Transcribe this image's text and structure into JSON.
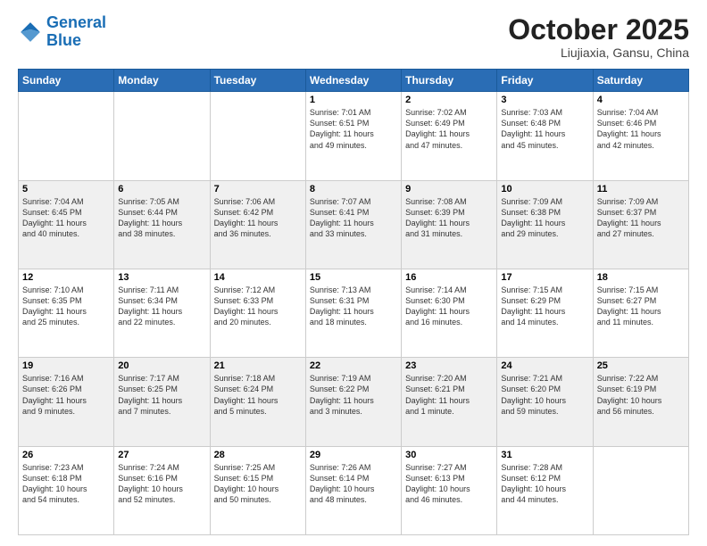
{
  "header": {
    "logo_line1": "General",
    "logo_line2": "Blue",
    "month": "October 2025",
    "location": "Liujiaxia, Gansu, China"
  },
  "days_of_week": [
    "Sunday",
    "Monday",
    "Tuesday",
    "Wednesday",
    "Thursday",
    "Friday",
    "Saturday"
  ],
  "weeks": [
    [
      {
        "day": "",
        "info": ""
      },
      {
        "day": "",
        "info": ""
      },
      {
        "day": "",
        "info": ""
      },
      {
        "day": "1",
        "info": "Sunrise: 7:01 AM\nSunset: 6:51 PM\nDaylight: 11 hours\nand 49 minutes."
      },
      {
        "day": "2",
        "info": "Sunrise: 7:02 AM\nSunset: 6:49 PM\nDaylight: 11 hours\nand 47 minutes."
      },
      {
        "day": "3",
        "info": "Sunrise: 7:03 AM\nSunset: 6:48 PM\nDaylight: 11 hours\nand 45 minutes."
      },
      {
        "day": "4",
        "info": "Sunrise: 7:04 AM\nSunset: 6:46 PM\nDaylight: 11 hours\nand 42 minutes."
      }
    ],
    [
      {
        "day": "5",
        "info": "Sunrise: 7:04 AM\nSunset: 6:45 PM\nDaylight: 11 hours\nand 40 minutes."
      },
      {
        "day": "6",
        "info": "Sunrise: 7:05 AM\nSunset: 6:44 PM\nDaylight: 11 hours\nand 38 minutes."
      },
      {
        "day": "7",
        "info": "Sunrise: 7:06 AM\nSunset: 6:42 PM\nDaylight: 11 hours\nand 36 minutes."
      },
      {
        "day": "8",
        "info": "Sunrise: 7:07 AM\nSunset: 6:41 PM\nDaylight: 11 hours\nand 33 minutes."
      },
      {
        "day": "9",
        "info": "Sunrise: 7:08 AM\nSunset: 6:39 PM\nDaylight: 11 hours\nand 31 minutes."
      },
      {
        "day": "10",
        "info": "Sunrise: 7:09 AM\nSunset: 6:38 PM\nDaylight: 11 hours\nand 29 minutes."
      },
      {
        "day": "11",
        "info": "Sunrise: 7:09 AM\nSunset: 6:37 PM\nDaylight: 11 hours\nand 27 minutes."
      }
    ],
    [
      {
        "day": "12",
        "info": "Sunrise: 7:10 AM\nSunset: 6:35 PM\nDaylight: 11 hours\nand 25 minutes."
      },
      {
        "day": "13",
        "info": "Sunrise: 7:11 AM\nSunset: 6:34 PM\nDaylight: 11 hours\nand 22 minutes."
      },
      {
        "day": "14",
        "info": "Sunrise: 7:12 AM\nSunset: 6:33 PM\nDaylight: 11 hours\nand 20 minutes."
      },
      {
        "day": "15",
        "info": "Sunrise: 7:13 AM\nSunset: 6:31 PM\nDaylight: 11 hours\nand 18 minutes."
      },
      {
        "day": "16",
        "info": "Sunrise: 7:14 AM\nSunset: 6:30 PM\nDaylight: 11 hours\nand 16 minutes."
      },
      {
        "day": "17",
        "info": "Sunrise: 7:15 AM\nSunset: 6:29 PM\nDaylight: 11 hours\nand 14 minutes."
      },
      {
        "day": "18",
        "info": "Sunrise: 7:15 AM\nSunset: 6:27 PM\nDaylight: 11 hours\nand 11 minutes."
      }
    ],
    [
      {
        "day": "19",
        "info": "Sunrise: 7:16 AM\nSunset: 6:26 PM\nDaylight: 11 hours\nand 9 minutes."
      },
      {
        "day": "20",
        "info": "Sunrise: 7:17 AM\nSunset: 6:25 PM\nDaylight: 11 hours\nand 7 minutes."
      },
      {
        "day": "21",
        "info": "Sunrise: 7:18 AM\nSunset: 6:24 PM\nDaylight: 11 hours\nand 5 minutes."
      },
      {
        "day": "22",
        "info": "Sunrise: 7:19 AM\nSunset: 6:22 PM\nDaylight: 11 hours\nand 3 minutes."
      },
      {
        "day": "23",
        "info": "Sunrise: 7:20 AM\nSunset: 6:21 PM\nDaylight: 11 hours\nand 1 minute."
      },
      {
        "day": "24",
        "info": "Sunrise: 7:21 AM\nSunset: 6:20 PM\nDaylight: 10 hours\nand 59 minutes."
      },
      {
        "day": "25",
        "info": "Sunrise: 7:22 AM\nSunset: 6:19 PM\nDaylight: 10 hours\nand 56 minutes."
      }
    ],
    [
      {
        "day": "26",
        "info": "Sunrise: 7:23 AM\nSunset: 6:18 PM\nDaylight: 10 hours\nand 54 minutes."
      },
      {
        "day": "27",
        "info": "Sunrise: 7:24 AM\nSunset: 6:16 PM\nDaylight: 10 hours\nand 52 minutes."
      },
      {
        "day": "28",
        "info": "Sunrise: 7:25 AM\nSunset: 6:15 PM\nDaylight: 10 hours\nand 50 minutes."
      },
      {
        "day": "29",
        "info": "Sunrise: 7:26 AM\nSunset: 6:14 PM\nDaylight: 10 hours\nand 48 minutes."
      },
      {
        "day": "30",
        "info": "Sunrise: 7:27 AM\nSunset: 6:13 PM\nDaylight: 10 hours\nand 46 minutes."
      },
      {
        "day": "31",
        "info": "Sunrise: 7:28 AM\nSunset: 6:12 PM\nDaylight: 10 hours\nand 44 minutes."
      },
      {
        "day": "",
        "info": ""
      }
    ]
  ]
}
